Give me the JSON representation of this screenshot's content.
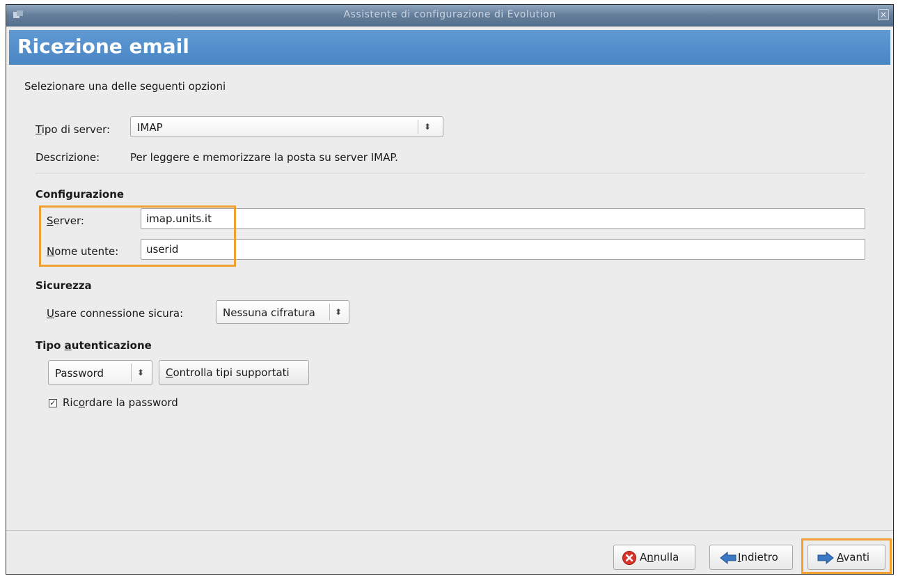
{
  "window": {
    "title": "Assistente di configurazione di Evolution",
    "close_glyph": "×"
  },
  "header": {
    "title": "Ricezione email"
  },
  "intro": "Selezionare una delle seguenti opzioni",
  "server_type": {
    "label_mnemonic": "T",
    "label_rest": "ipo di server:",
    "value": "IMAP",
    "description_label": "Descrizione:",
    "description": "Per leggere e memorizzare la posta su server IMAP."
  },
  "configuration": {
    "heading": "Configurazione",
    "server_label_mnemonic": "S",
    "server_label_rest": "erver:",
    "server_value": "imap.units.it",
    "user_label_mnemonic": "N",
    "user_label_rest": "ome utente:",
    "user_value": "userid"
  },
  "security": {
    "heading": "Sicurezza",
    "label_mnemonic": "U",
    "label_rest": "sare connessione sicura:",
    "value": "Nessuna cifratura"
  },
  "auth": {
    "heading_pre": "Tipo ",
    "heading_mnemonic": "a",
    "heading_rest": "utenticazione",
    "type_value": "Password",
    "check_mnemonic": "C",
    "check_rest": "ontrolla tipi supportati",
    "remember_pre": "Ric",
    "remember_mnemonic": "o",
    "remember_rest": "rdare la password",
    "remember_checked": true
  },
  "footer": {
    "cancel_pre": "A",
    "cancel_mnemonic": "n",
    "cancel_rest": "nulla",
    "back_mnemonic": "I",
    "back_rest": "ndietro",
    "next_mnemonic": "A",
    "next_rest": "vanti"
  },
  "colors": {
    "header_blue": "#4a86c4",
    "highlight_orange": "#f0a030",
    "cancel_red": "#d9342b",
    "arrow_blue": "#3a78c4"
  },
  "icons": {
    "combo_arrow": "⬍",
    "check_mark": "✓"
  }
}
